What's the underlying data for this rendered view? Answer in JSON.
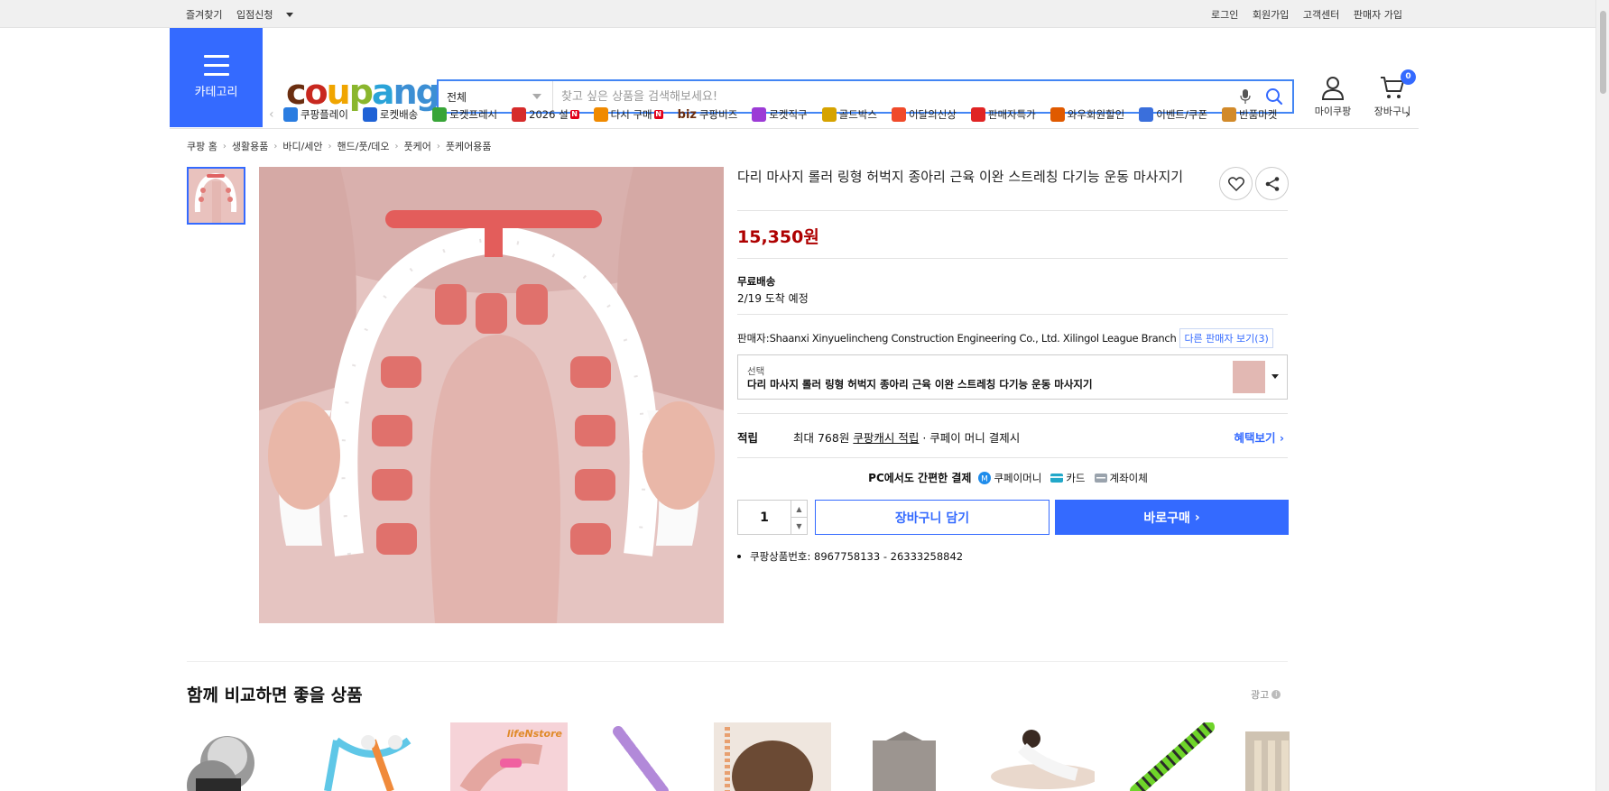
{
  "topbar": {
    "left": [
      "즐겨찾기",
      "입점신청"
    ],
    "right": [
      "로그인",
      "회원가입",
      "고객센터",
      "판매자 가입"
    ]
  },
  "header": {
    "category_label": "카테고리",
    "logo_text": "coupang",
    "search": {
      "category": "전체",
      "placeholder": "찾고 싶은 상품을 검색해보세요!"
    },
    "mycoupang_label": "마이쿠팡",
    "cart_label": "장바구니",
    "cart_count": "0"
  },
  "nav": [
    {
      "label": "쿠팡플레이",
      "icon": "play-icon",
      "color": "#2a7de1"
    },
    {
      "label": "로켓배송",
      "icon": "rocket-icon",
      "color": "#1f62d6"
    },
    {
      "label": "로켓프레시",
      "icon": "rocket-fresh-icon",
      "color": "#38a538"
    },
    {
      "label": "2026 설",
      "icon": "gift-icon",
      "color": "#d62b2b",
      "new": "N"
    },
    {
      "label": "다시 구매",
      "icon": "house-icon",
      "color": "#f08a00",
      "new": "N"
    },
    {
      "label": "쿠팡비즈",
      "icon": "biz-icon",
      "prefix": "biz",
      "color": "#6b2e10"
    },
    {
      "label": "로켓직구",
      "icon": "global-rocket-icon",
      "color": "#9c3bd6"
    },
    {
      "label": "골드박스",
      "icon": "goldbox-icon",
      "color": "#d6a300"
    },
    {
      "label": "이달의신상",
      "icon": "new-bag-icon",
      "color": "#f04a2a"
    },
    {
      "label": "판매자특가",
      "icon": "percent-icon",
      "color": "#e02424"
    },
    {
      "label": "와우회원할인",
      "icon": "wow-icon",
      "color": "#e05a00"
    },
    {
      "label": "이벤트/쿠폰",
      "icon": "coupon-icon",
      "color": "#3a6fdc"
    },
    {
      "label": "반품마켓",
      "icon": "market-icon",
      "color": "#d28a2a"
    }
  ],
  "breadcrumb": [
    "쿠팡 홈",
    "생활용품",
    "바디/세안",
    "핸드/풋/데오",
    "풋케어",
    "풋케어용품"
  ],
  "product": {
    "title": "다리 마사지 롤러 링형 허벅지 종아리 근육 이완 스트레칭 다기능 운동 마사지기",
    "price": "15,350원",
    "shipping_type": "무료배송",
    "arrival": "2/19 도착 예정",
    "seller_prefix": "판매자:",
    "seller_name": "Shaanxi Xinyuelincheng Construction Engineering Co., Ltd. Xilingol League Branch",
    "other_sellers": "다른 판매자 보기(3)",
    "option_label": "선택",
    "option_value": "다리 마사지 롤러 링형 허벅지 종아리 근육 이완 스트레칭 다기능 운동 마사지기",
    "cash_label": "적립",
    "cash_amount": "최대 768원",
    "cash_link": "쿠팡캐시 적립",
    "cash_suffix": "· 쿠페이 머니 결제시",
    "benefit_link": "혜택보기",
    "pay_note": "PC에서도 간편한 결제",
    "pay_methods": [
      "쿠페이머니",
      "카드",
      "계좌이체"
    ],
    "quantity": "1",
    "add_to_cart": "장바구니 담기",
    "buy_now": "바로구매",
    "product_id": "쿠팡상품번호: 8967758133 - 26333258842"
  },
  "recommend": {
    "title": "함께 비교하면 좋을 상품",
    "ad_label": "광고",
    "item_store_text": "lifeNstore"
  },
  "colors": {
    "accent": "#346aff",
    "price": "#ae0000"
  }
}
